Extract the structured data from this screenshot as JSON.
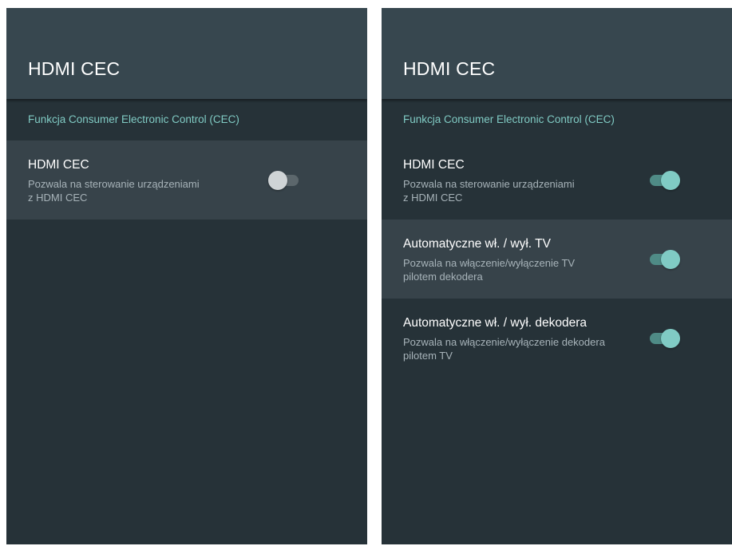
{
  "left_panel": {
    "header_title": "HDMI CEC",
    "section_title": "Funkcja Consumer Electronic Control (CEC)",
    "items": [
      {
        "title": "HDMI CEC",
        "summary": "Pozwala na sterowanie urządzeniami\nz HDMI CEC",
        "toggle_state": "off"
      }
    ]
  },
  "right_panel": {
    "header_title": "HDMI CEC",
    "section_title": "Funkcja Consumer Electronic Control (CEC)",
    "items": [
      {
        "title": "HDMI CEC",
        "summary": "Pozwala na sterowanie urządzeniami\nz HDMI CEC",
        "toggle_state": "on"
      },
      {
        "title": "Automatyczne wł. / wył. TV",
        "summary": "Pozwala na włączenie/wyłączenie TV\npilotem dekodera",
        "toggle_state": "on"
      },
      {
        "title": "Automatyczne wł. / wył. dekodera",
        "summary": "Pozwala na włączenie/wyłączenie dekodera\npilotem TV",
        "toggle_state": "on"
      }
    ]
  },
  "colors": {
    "background": "#263238",
    "header": "#37474f",
    "focused_row": "#37434a",
    "accent": "#80cbc4",
    "toggle_off_thumb": "#cfd4d6"
  }
}
